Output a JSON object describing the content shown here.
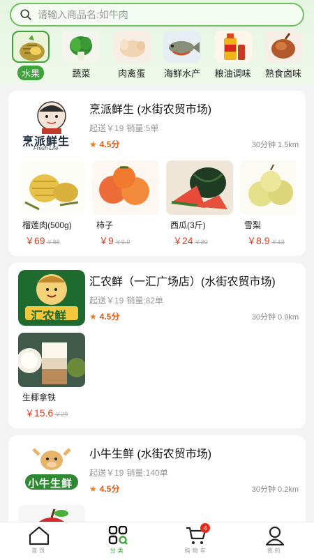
{
  "search": {
    "placeholder": "请输入商品名:如牛肉"
  },
  "categories": [
    {
      "label": "水果",
      "active": true
    },
    {
      "label": "蔬菜"
    },
    {
      "label": "肉禽蛋"
    },
    {
      "label": "海鲜水产"
    },
    {
      "label": "粮油调味"
    },
    {
      "label": "熟食卤味"
    }
  ],
  "shops": [
    {
      "name": "烹派鲜生 (水街农贸市场)",
      "logo_text": "烹派鲜生",
      "logo_sub": "Fresh Life",
      "min_order": "起送￥19",
      "sales": "销量:5单",
      "rating": "4.5分",
      "distance": "30分钟 1.5km",
      "goods": [
        {
          "name": "榴莲肉(500g)",
          "price_symbol": "￥",
          "price": "69",
          "old": "￥88"
        },
        {
          "name": "柿子",
          "price_symbol": "￥",
          "price": "9",
          "old": "￥9.9"
        },
        {
          "name": "西瓜(3斤)",
          "price_symbol": "￥",
          "price": "24",
          "old": "￥30"
        },
        {
          "name": "雪梨",
          "price_symbol": "￥",
          "price": "8.9",
          "old": "￥13"
        }
      ]
    },
    {
      "name": "汇农鲜（一汇广场店）(水街农贸市场)",
      "logo_text": "汇农鲜",
      "min_order": "起送￥19",
      "sales": "销量:82单",
      "rating": "4.5分",
      "distance": "30分钟 0.9km",
      "goods": [
        {
          "name": "生椰拿铁",
          "price_symbol": "￥",
          "price": "15.6",
          "old": "￥29"
        }
      ]
    },
    {
      "name": "小牛生鲜 (水街农贸市场)",
      "logo_text": "小牛生鲜",
      "min_order": "起送￥19",
      "sales": "销量:140单",
      "rating": "4.5分",
      "distance": "30分钟 0.2km",
      "goods": []
    }
  ],
  "tabbar": {
    "home": "首页",
    "category": "分类",
    "cart": "购物车",
    "cart_badge": "4",
    "me": "我的"
  },
  "colors": {
    "accent": "#3da33a",
    "price": "#e13b1f",
    "rating": "#e05a14"
  }
}
